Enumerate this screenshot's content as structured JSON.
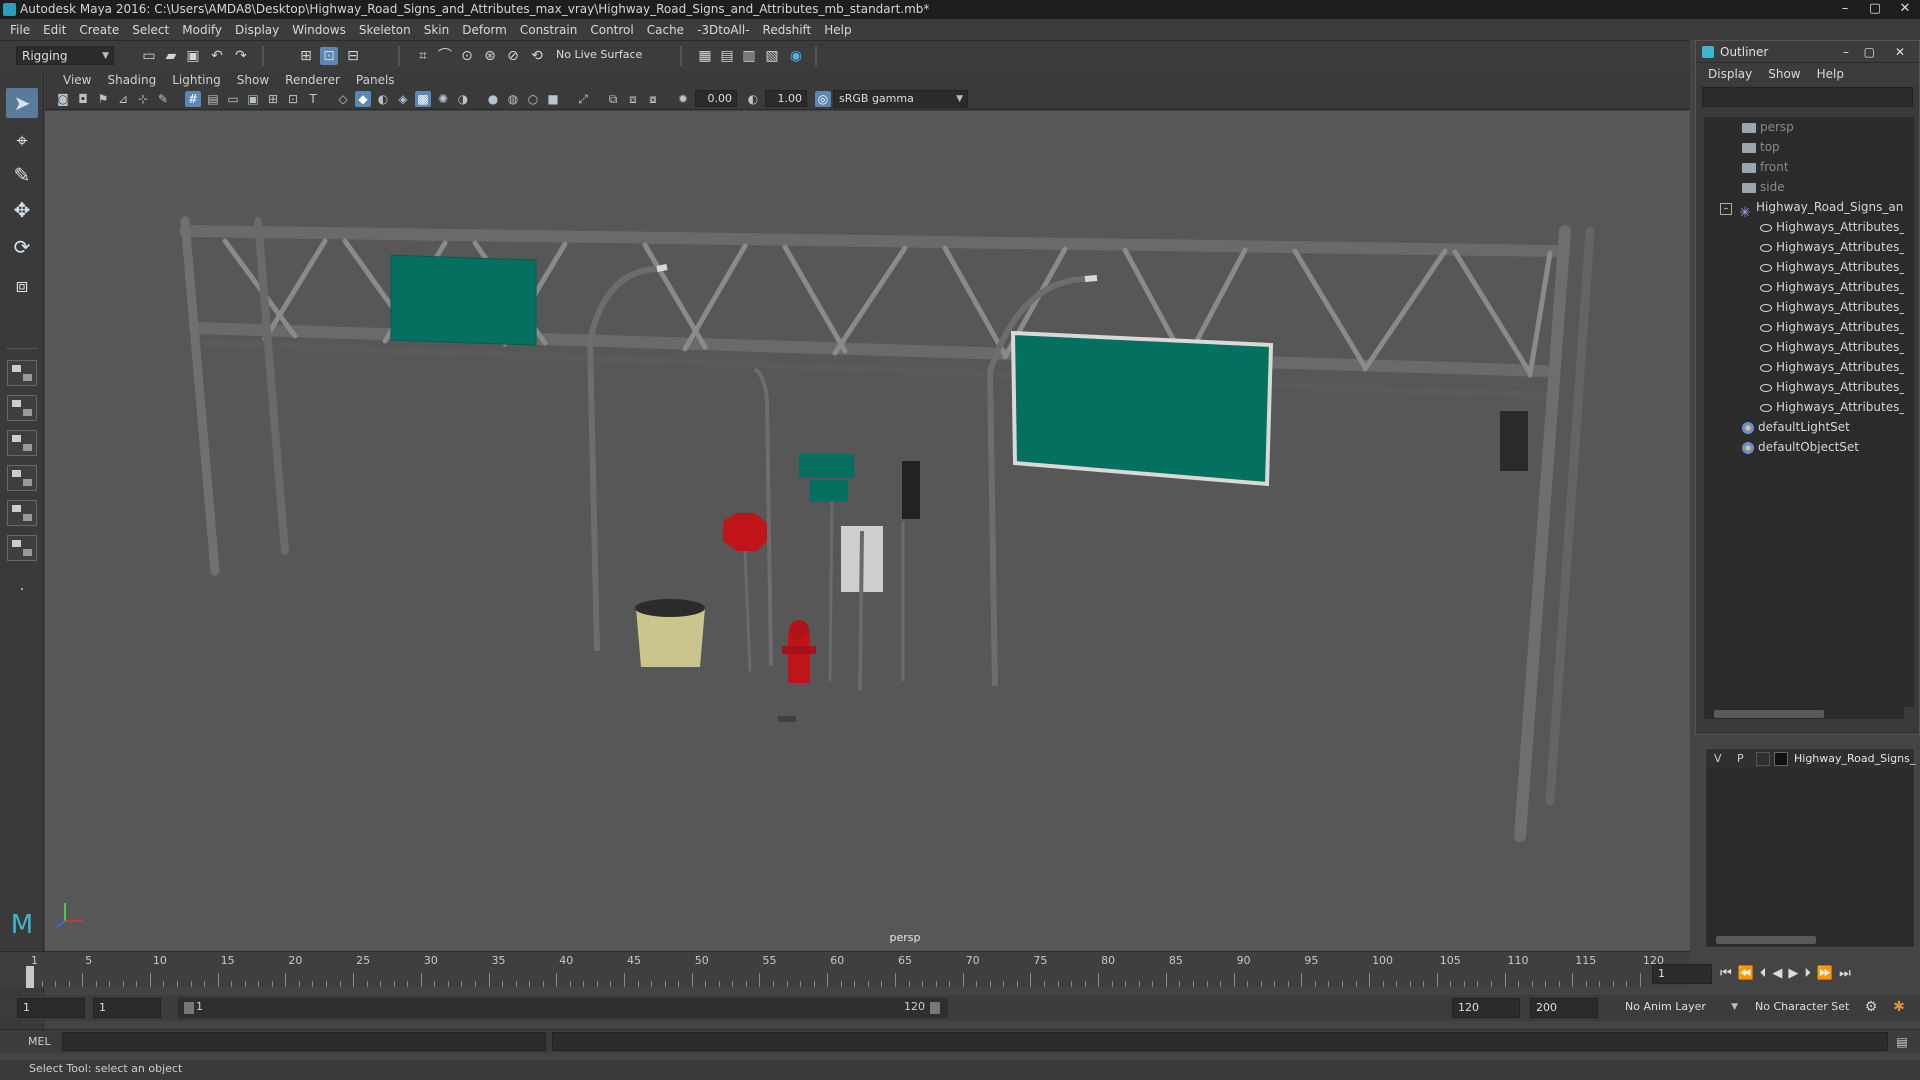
{
  "window": {
    "title": "Autodesk Maya 2016: C:\\Users\\AMDA8\\Desktop\\Highway_Road_Signs_and_Attributes_max_vray\\Highway_Road_Signs_and_Attributes_mb_standart.mb*",
    "minimize": "–",
    "maximize": "▢",
    "close": "✕"
  },
  "menubar": [
    "File",
    "Edit",
    "Create",
    "Select",
    "Modify",
    "Display",
    "Windows",
    "Skeleton",
    "Skin",
    "Deform",
    "Constrain",
    "Control",
    "Cache",
    "-3DtoAll-",
    "Redshift",
    "Help"
  ],
  "toolbar": {
    "menuset": "Rigging",
    "live_surface": "No Live Surface"
  },
  "viewport": {
    "menus": [
      "View",
      "Shading",
      "Lighting",
      "Show",
      "Renderer",
      "Panels"
    ],
    "exposure": "0.00",
    "gamma": "1.00",
    "colorspace": "sRGB gamma",
    "camera_label": "persp"
  },
  "timeline": {
    "labels": [
      "1",
      "5",
      "10",
      "15",
      "20",
      "25",
      "30",
      "35",
      "40",
      "45",
      "50",
      "55",
      "60",
      "65",
      "70",
      "75",
      "80",
      "85",
      "90",
      "95",
      "100",
      "105",
      "110",
      "115",
      "120"
    ],
    "current_frame": "1"
  },
  "range": {
    "start": "1",
    "anim_start": "1",
    "slider_start": "1",
    "slider_end": "120",
    "anim_end_a": "120",
    "anim_end_b": "200",
    "anim_layer": "No Anim Layer",
    "character_set": "No Character Set"
  },
  "command": {
    "lang": "MEL",
    "status": "Select Tool: select an object"
  },
  "outliner": {
    "title": "Outliner",
    "menu": [
      "Display",
      "Show",
      "Help"
    ],
    "cameras": [
      "persp",
      "top",
      "front",
      "side"
    ],
    "group": "Highway_Road_Signs_and",
    "children": [
      "Highways_Attributes_E",
      "Highways_Attributes_s",
      "Highways_Attributes_s",
      "Highways_Attributes_t",
      "Highways_Attributes_t",
      "Highways_Attributes_s",
      "Highways_Attributes_f",
      "Highways_Attributes_l",
      "Highways_Attributes_t",
      "Highways_Attributes_t"
    ],
    "sets": [
      "defaultLightSet",
      "defaultObjectSet"
    ]
  },
  "layers": {
    "v": "V",
    "p": "P",
    "layer_name": "Highway_Road_Signs_"
  },
  "colors": {
    "sign_green": "#05705f",
    "hydrant_red": "#c0141b",
    "bin_yellow": "#c9c58d",
    "accent": "#5a87b3"
  }
}
